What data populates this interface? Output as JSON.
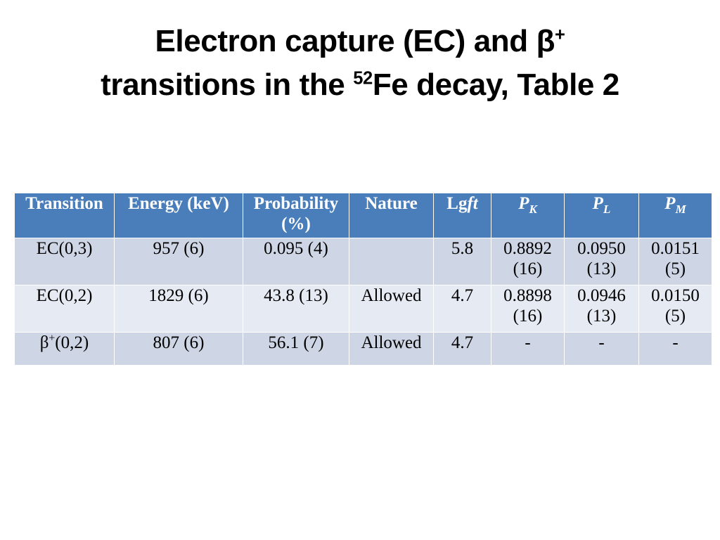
{
  "slide": {
    "title_line1_a": "Electron capture (EC) and β",
    "title_line1_sup": "+",
    "title_line2_a": "transitions in the ",
    "title_line2_sup": "52",
    "title_line2_b": "Fe decay, Table 2"
  },
  "theme": {
    "header_bg": "#4a7ebb",
    "header_text": "#ffffff",
    "row_dark_bg": "#ced5e4",
    "row_light_bg": "#e6eaf3",
    "body_text": "#000000",
    "page_bg": "#ffffff"
  },
  "table": {
    "headers": [
      {
        "label": "Transition",
        "line2": ""
      },
      {
        "label": "Energy (keV)",
        "line2": ""
      },
      {
        "label": "Probability",
        "line2": "(%)"
      },
      {
        "label": "Nature",
        "line2": ""
      },
      {
        "label_a": "Lg",
        "label_italic": "ft"
      },
      {
        "label_p": "P",
        "sub": "K"
      },
      {
        "label_p": "P",
        "sub": "L"
      },
      {
        "label_p": "P",
        "sub": "M"
      }
    ],
    "rows": [
      {
        "transition": "EC(0,3)",
        "transition_sup": "",
        "energy": "957 (6)",
        "probability": "0.095 (4)",
        "nature": "",
        "lgft": "5.8",
        "pk": "0.8892",
        "pk2": "(16)",
        "pl": "0.0950",
        "pl2": "(13)",
        "pm": "0.0151",
        "pm2": "(5)"
      },
      {
        "transition": "EC(0,2)",
        "transition_sup": "",
        "energy": "1829 (6)",
        "probability": "43.8 (13)",
        "nature": "Allowed",
        "lgft": "4.7",
        "pk": "0.8898",
        "pk2": "(16)",
        "pl": "0.0946",
        "pl2": "(13)",
        "pm": "0.0150",
        "pm2": "(5)"
      },
      {
        "transition": "β",
        "transition_sup": "+",
        "transition_rest": "(0,2)",
        "energy": "807 (6)",
        "probability": "56.1 (7)",
        "nature": "Allowed",
        "lgft": "4.7",
        "pk": "-",
        "pk2": "",
        "pl": "-",
        "pl2": "",
        "pm": "-",
        "pm2": ""
      }
    ]
  }
}
